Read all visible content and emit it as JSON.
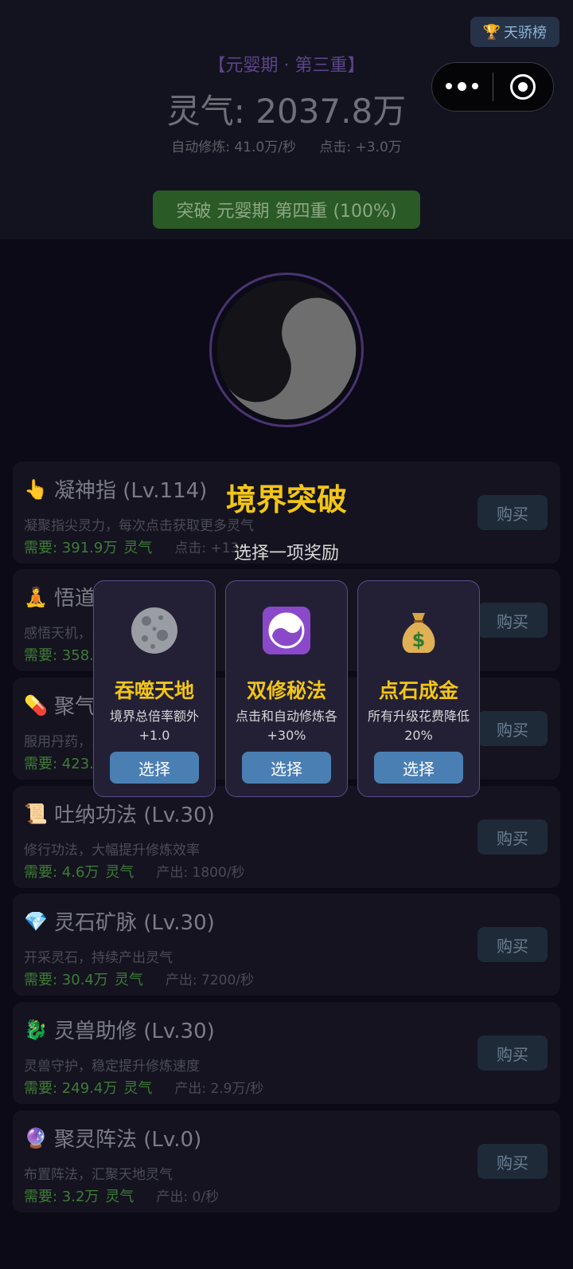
{
  "header": {
    "rank_button": "天骄榜",
    "realm": "【元婴期 · 第三重】",
    "qi": "灵气: 2037.8万",
    "auto_rate": "自动修炼: 41.0万/秒",
    "click_rate": "点击: +3.0万",
    "breakthrough_label": "突破 元婴期 第四重 (100%)"
  },
  "upgrades": [
    {
      "icon": "pointing-finger-icon",
      "emoji": "👆",
      "title": "凝神指 (Lv.114)",
      "desc": "凝聚指尖灵力，每次点击获取更多灵气",
      "cost": "需要: 391.9万",
      "unit": "灵气",
      "effect": "点击: +13...",
      "buy": "购买"
    },
    {
      "icon": "meditation-icon",
      "emoji": "🧘",
      "title": "悟道...",
      "desc": "感悟天机，...",
      "cost": "需要: 358...",
      "unit": "",
      "effect": "",
      "buy": "购买"
    },
    {
      "icon": "pill-icon",
      "emoji": "💊",
      "title": "聚气...",
      "desc": "服用丹药，...",
      "cost": "需要: 423...",
      "unit": "",
      "effect": "",
      "buy": "购买"
    },
    {
      "icon": "scroll-icon",
      "emoji": "📜",
      "title": "吐纳功法 (Lv.30)",
      "desc": "修行功法，大幅提升修炼效率",
      "cost": "需要: 4.6万",
      "unit": "灵气",
      "effect": "产出: 1800/秒",
      "buy": "购买"
    },
    {
      "icon": "gem-icon",
      "emoji": "💎",
      "title": "灵石矿脉 (Lv.30)",
      "desc": "开采灵石，持续产出灵气",
      "cost": "需要: 30.4万",
      "unit": "灵气",
      "effect": "产出: 7200/秒",
      "buy": "购买"
    },
    {
      "icon": "dragon-icon",
      "emoji": "🐉",
      "title": "灵兽助修 (Lv.30)",
      "desc": "灵兽守护，稳定提升修炼速度",
      "cost": "需要: 249.4万",
      "unit": "灵气",
      "effect": "产出: 2.9万/秒",
      "buy": "购买"
    },
    {
      "icon": "crystal-ball-icon",
      "emoji": "🔮",
      "title": "聚灵阵法 (Lv.0)",
      "desc": "布置阵法，汇聚天地灵气",
      "cost": "需要: 3.2万",
      "unit": "灵气",
      "effect": "产出: 0/秒",
      "buy": "购买"
    }
  ],
  "modal": {
    "title": "境界突破",
    "subtitle": "选择一项奖励",
    "cards": [
      {
        "icon": "moon-icon",
        "name": "吞噬天地",
        "desc": "境界总倍率额外+1.0",
        "select": "选择"
      },
      {
        "icon": "yin-yang-icon",
        "name": "双修秘法",
        "desc": "点击和自动修炼各+30%",
        "select": "选择"
      },
      {
        "icon": "money-bag-icon",
        "name": "点石成金",
        "desc": "所有升级花费降低20%",
        "select": "选择"
      }
    ]
  }
}
